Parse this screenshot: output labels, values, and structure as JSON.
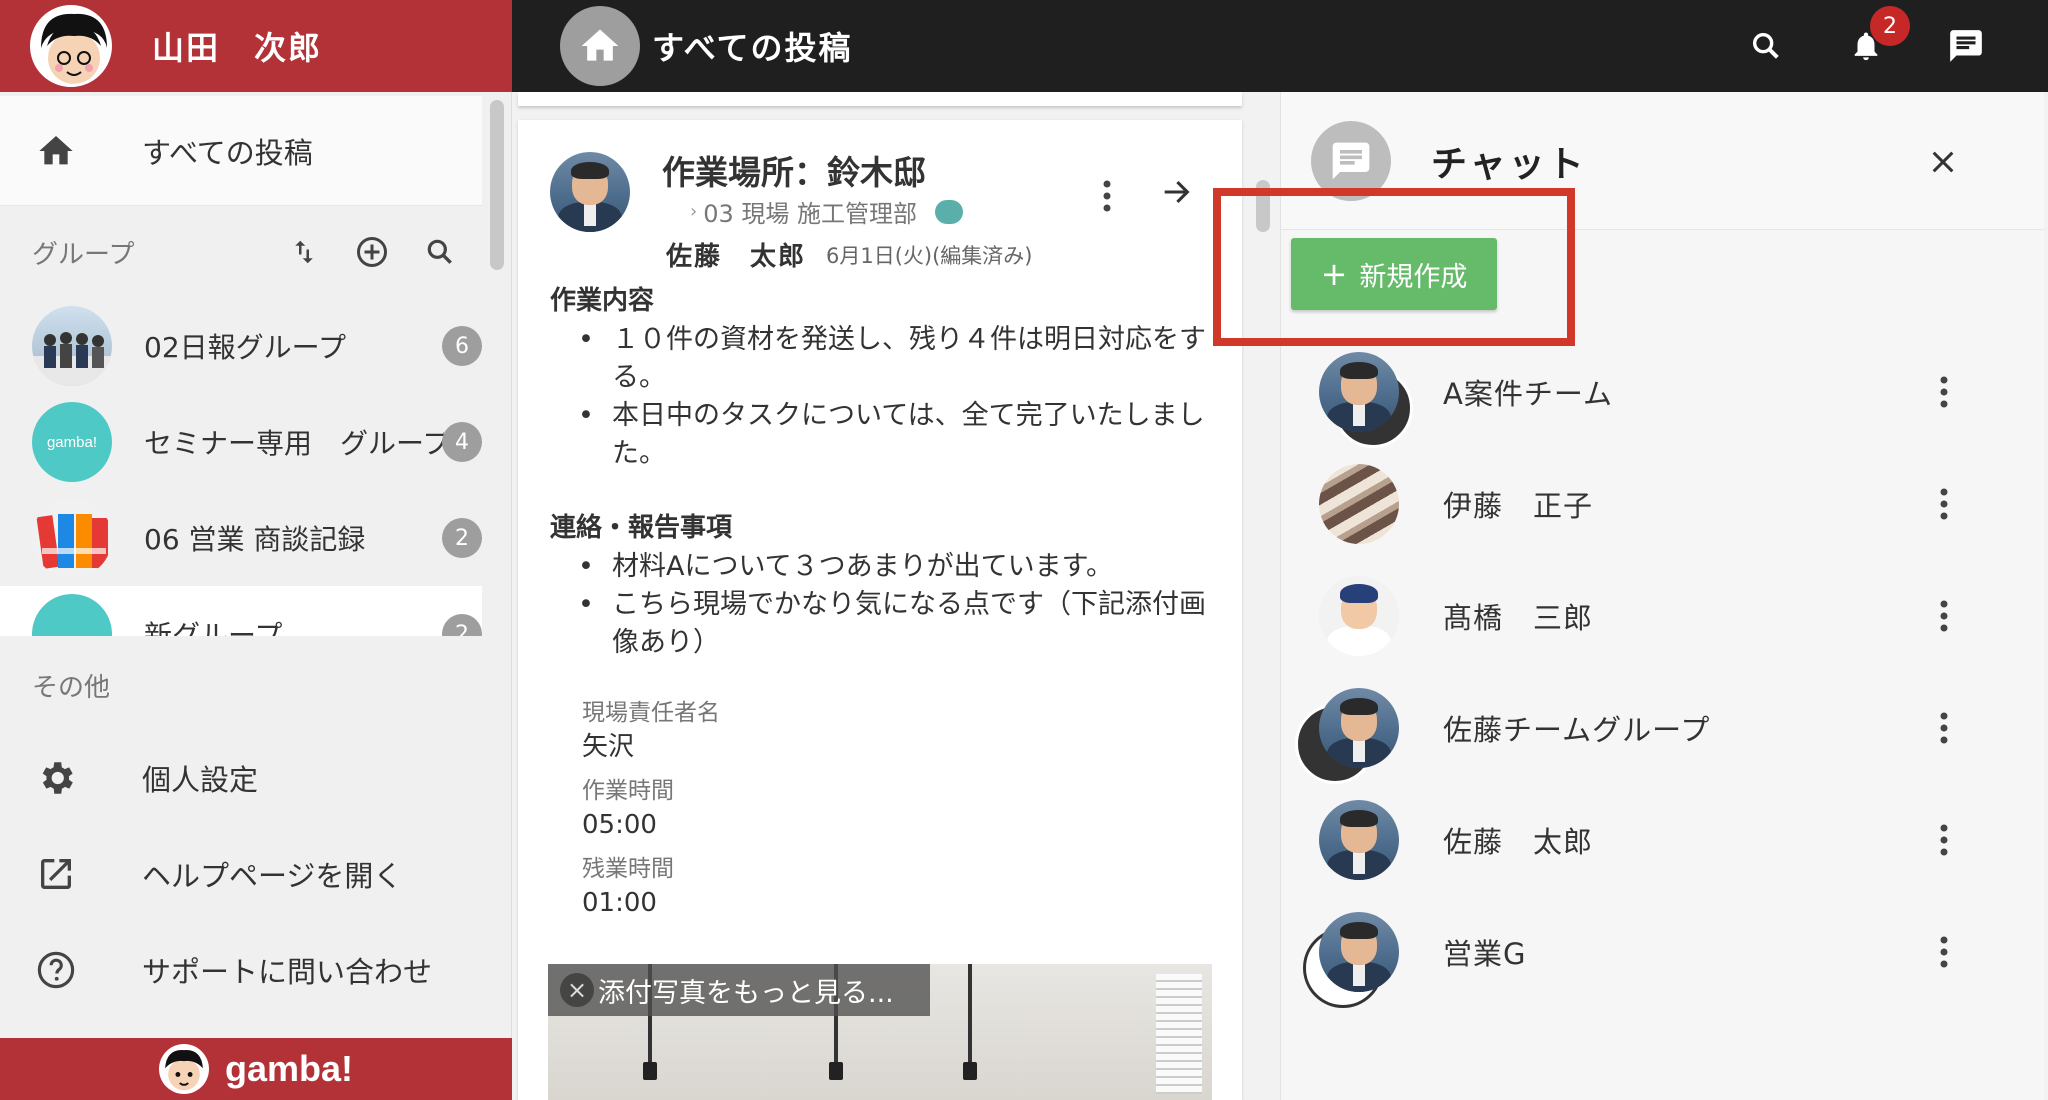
{
  "user": {
    "name": "山田　次郎"
  },
  "topbar": {
    "title": "すべての投稿",
    "notification_count": "2"
  },
  "sidebar": {
    "all_posts": "すべての投稿",
    "group_heading": "グループ",
    "groups": [
      {
        "name": "02日報グループ",
        "count": "6"
      },
      {
        "name": "セミナー専用　グループ",
        "count": "4",
        "avatar_text": "gamba!"
      },
      {
        "name": "06 営業 商談記録",
        "count": "2"
      },
      {
        "name": "新グループ",
        "count": "2"
      }
    ],
    "other_heading": "その他",
    "items": [
      {
        "label": "個人設定"
      },
      {
        "label": "ヘルプページを開く"
      },
      {
        "label": "サポートに問い合わせ"
      }
    ],
    "footer_logo": "gamba!"
  },
  "post": {
    "title": "作業場所：鈴木邸",
    "group": "03 現場 施工管理部",
    "author": "佐藤　太郎",
    "date": "6月1日(火)(編集済み)",
    "sections": [
      {
        "heading": "作業内容",
        "bullets": [
          "１０件の資材を発送し、残り４件は明日対応をする。",
          "本日中のタスクについては、全て完了いたしました。"
        ]
      },
      {
        "heading": "連絡・報告事項",
        "bullets": [
          "材料Aについて３つあまりが出ています。",
          "こちら現場でかなり気になる点です（下記添付画像あり）"
        ]
      }
    ],
    "fields": [
      {
        "label": "現場責任者名",
        "value": "矢沢"
      },
      {
        "label": "作業時間",
        "value": "05:00"
      },
      {
        "label": "残業時間",
        "value": "01:00"
      }
    ],
    "photo_more": "添付写真をもっと見る..."
  },
  "chat": {
    "title": "チャット",
    "new_button": "新規作成",
    "rooms": [
      {
        "name": "A案件チーム"
      },
      {
        "name": "伊藤　正子"
      },
      {
        "name": "髙橋　三郎"
      },
      {
        "name": "佐藤チームグループ"
      },
      {
        "name": "佐藤　太郎"
      },
      {
        "name": "営業G"
      }
    ]
  },
  "colors": {
    "brand_red": "#b23238",
    "topbar": "#1f1f1f",
    "new_button_green": "#66bb6a",
    "highlight_red": "#d0382a",
    "teal_dot": "#5aafaa"
  }
}
